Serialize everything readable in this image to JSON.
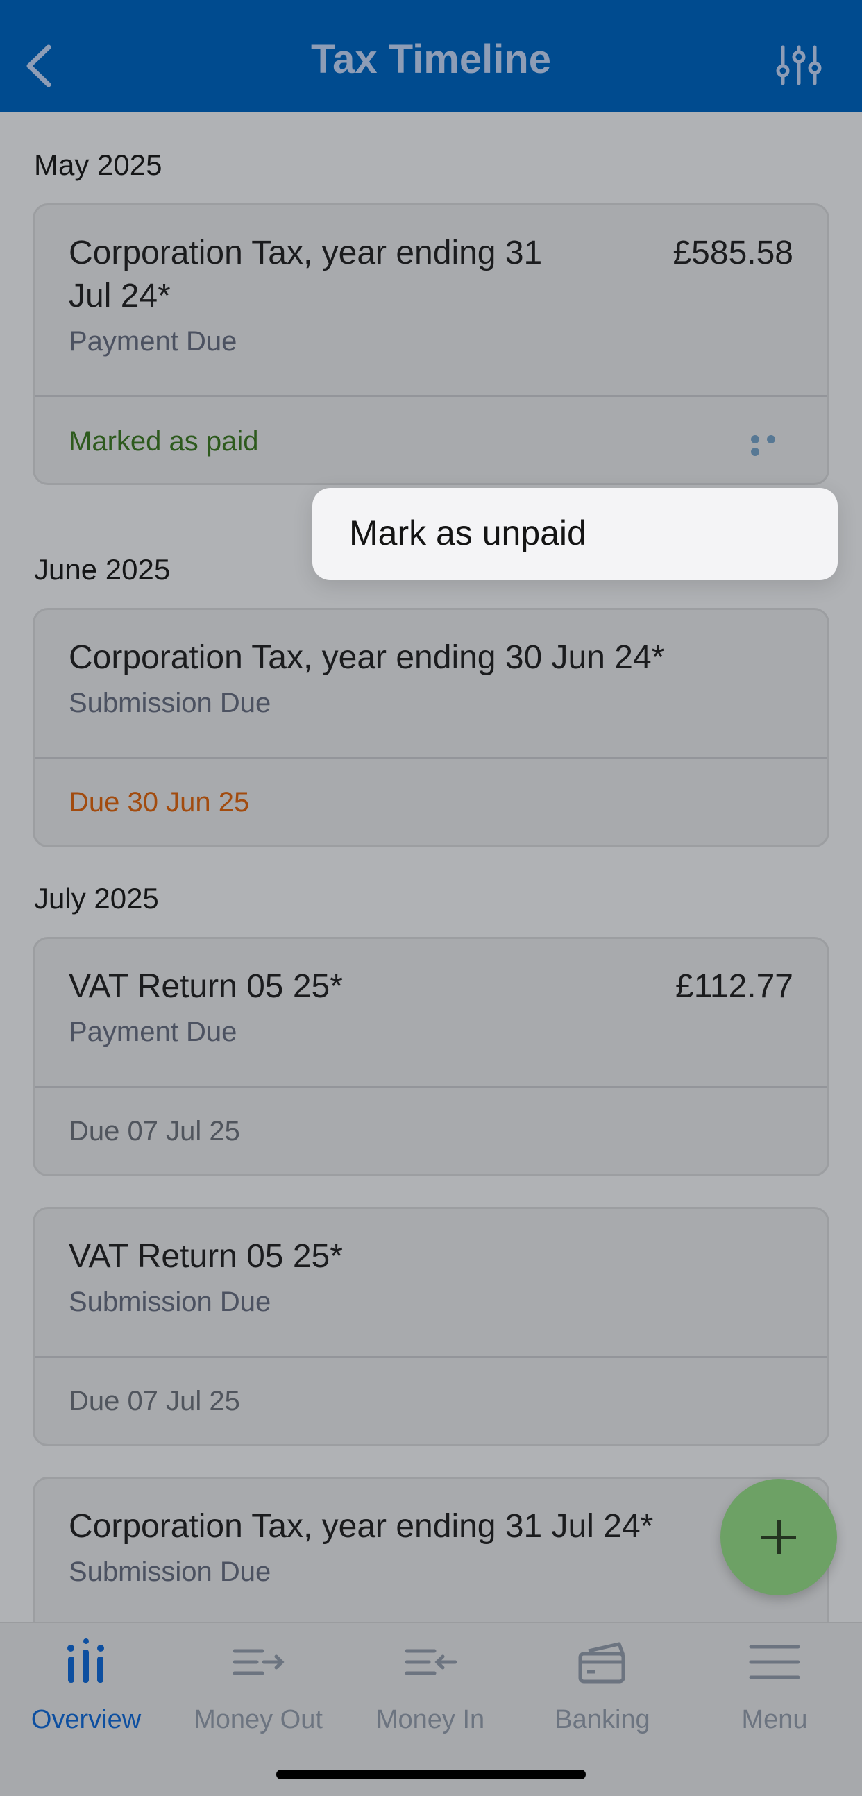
{
  "header": {
    "title": "Tax Timeline",
    "back_icon": "chevron-left-icon",
    "filter_icon": "sliders-icon"
  },
  "sections": [
    {
      "month": "May 2025"
    },
    {
      "month": "June 2025"
    },
    {
      "month": "July 2025"
    }
  ],
  "cards": [
    {
      "title_line1": "Corporation Tax, year ending 31",
      "title_line2": "Jul 24*",
      "subtitle": "Payment Due",
      "amount": "£585.58",
      "status": "Marked as paid"
    },
    {
      "title": "Corporation Tax, year ending 30 Jun 24*",
      "subtitle": "Submission Due",
      "status": "Due 30 Jun 25"
    },
    {
      "title": "VAT Return 05 25*",
      "subtitle": "Payment Due",
      "amount": "£112.77",
      "status": "Due 07 Jul 25"
    },
    {
      "title": "VAT Return 05 25*",
      "subtitle": "Submission Due",
      "status": "Due 07 Jul 25"
    },
    {
      "title": "Corporation Tax, year ending 31 Jul 24*",
      "subtitle": "Submission Due"
    }
  ],
  "popup": {
    "item": "Mark as unpaid"
  },
  "fab": {
    "icon": "plus-icon"
  },
  "tabs": [
    {
      "label": "Overview",
      "icon": "bar-chart-icon",
      "active": true
    },
    {
      "label": "Money Out",
      "icon": "money-out-icon"
    },
    {
      "label": "Money In",
      "icon": "money-in-icon"
    },
    {
      "label": "Banking",
      "icon": "card-icon"
    },
    {
      "label": "Menu",
      "icon": "hamburger-icon"
    }
  ],
  "colors": {
    "header_bg": "#004b8f",
    "accent": "#0d4fa0",
    "paid_green": "#2d5a1d",
    "due_orange": "#a24b0e",
    "fab": "#6da165"
  }
}
